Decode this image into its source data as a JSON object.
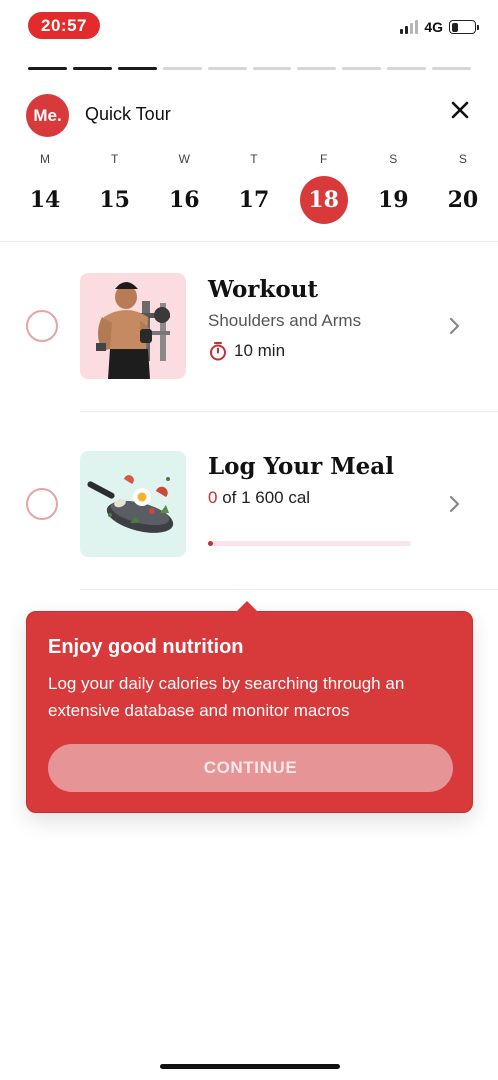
{
  "status_bar": {
    "time": "20:57",
    "network": "4G",
    "signal_bars_on": 2,
    "signal_bars_total": 4,
    "battery_level": 0.3
  },
  "progress": {
    "completed_steps": 3,
    "total_steps": 10
  },
  "header": {
    "logo_text": "Me.",
    "title": "Quick Tour"
  },
  "week": {
    "days": [
      {
        "letter": "M",
        "number": "14"
      },
      {
        "letter": "T",
        "number": "15"
      },
      {
        "letter": "W",
        "number": "16"
      },
      {
        "letter": "T",
        "number": "17"
      },
      {
        "letter": "F",
        "number": "18"
      },
      {
        "letter": "S",
        "number": "19"
      },
      {
        "letter": "S",
        "number": "20"
      }
    ],
    "selected_index": 4
  },
  "tasks": {
    "workout": {
      "title": "Workout",
      "subtitle": "Shoulders and Arms",
      "duration": "10 min",
      "icon": "stopwatch-icon"
    },
    "meal": {
      "title": "Log Your Meal",
      "consumed": "0",
      "target": " of 1 600 cal",
      "progress": 0.0
    }
  },
  "tooltip": {
    "title": "Enjoy good nutrition",
    "body": "Log your daily calories by searching through an extensive database and monitor macros",
    "button": "CONTINUE"
  },
  "colors": {
    "accent": "#d8393a",
    "workout_bg": "#fbdde1",
    "meal_bg": "#dff4ef"
  }
}
